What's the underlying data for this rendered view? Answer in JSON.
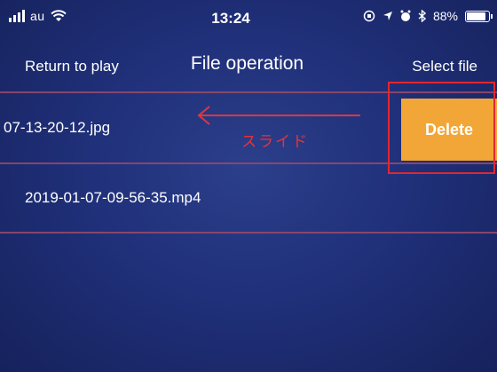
{
  "status_bar": {
    "carrier": "au",
    "time": "13:24",
    "battery": "88%"
  },
  "nav": {
    "left": "Return to play",
    "title": "File operation",
    "right": "Select file"
  },
  "files": [
    {
      "name": "07-13-20-12.jpg",
      "action": "Delete"
    },
    {
      "name": "2019-01-07-09-56-35.mp4"
    }
  ],
  "annotation": {
    "slide_label": "スライド",
    "color": "#e5343a"
  },
  "colors": {
    "delete_bg": "#f2a637",
    "divider": "#9a4a6a",
    "background": "#20307a"
  }
}
